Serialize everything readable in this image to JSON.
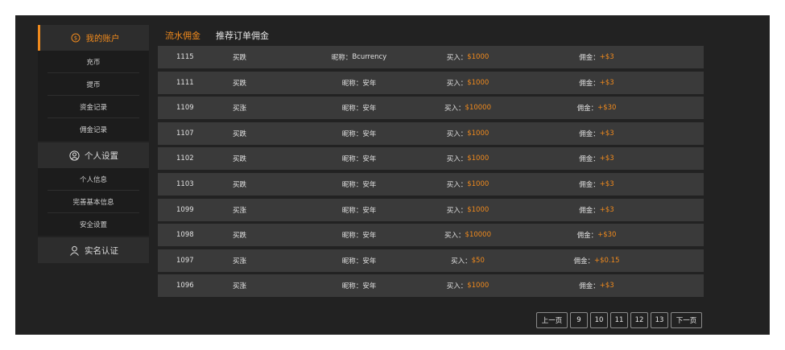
{
  "sidebar": {
    "sections": [
      {
        "title": "我的账户",
        "icon": "dollar-circle-icon",
        "active": true,
        "items": [
          "充币",
          "提币",
          "资金记录",
          "佣金记录"
        ]
      },
      {
        "title": "个人设置",
        "icon": "user-circle-icon",
        "active": false,
        "items": [
          "个人信息",
          "完善基本信息",
          "安全设置"
        ]
      },
      {
        "title": "实名认证",
        "icon": "user-icon",
        "active": false,
        "items": []
      }
    ]
  },
  "tabs": [
    {
      "label": "流水佣金",
      "active": true
    },
    {
      "label": "推荐订单佣金",
      "active": false
    }
  ],
  "labels": {
    "nickname_prefix": "昵称：",
    "buy_prefix": "买入：",
    "commission_prefix": "佣金："
  },
  "rows": [
    {
      "id": "1115",
      "type": "买跌",
      "nickname": "Bcurrency",
      "buy": "$1000",
      "commission": "+$3"
    },
    {
      "id": "1111",
      "type": "买跌",
      "nickname": "安年",
      "buy": "$1000",
      "commission": "+$3"
    },
    {
      "id": "1109",
      "type": "买涨",
      "nickname": "安年",
      "buy": "$10000",
      "commission": "+$30"
    },
    {
      "id": "1107",
      "type": "买跌",
      "nickname": "安年",
      "buy": "$1000",
      "commission": "+$3"
    },
    {
      "id": "1102",
      "type": "买跌",
      "nickname": "安年",
      "buy": "$1000",
      "commission": "+$3"
    },
    {
      "id": "1103",
      "type": "买跌",
      "nickname": "安年",
      "buy": "$1000",
      "commission": "+$3"
    },
    {
      "id": "1099",
      "type": "买涨",
      "nickname": "安年",
      "buy": "$1000",
      "commission": "+$3"
    },
    {
      "id": "1098",
      "type": "买跌",
      "nickname": "安年",
      "buy": "$10000",
      "commission": "+$30"
    },
    {
      "id": "1097",
      "type": "买涨",
      "nickname": "安年",
      "buy": "$50",
      "commission": "+$0.15"
    },
    {
      "id": "1096",
      "type": "买涨",
      "nickname": "安年",
      "buy": "$1000",
      "commission": "+$3"
    }
  ],
  "pagination": {
    "prev_label": "上一页",
    "pages": [
      "9",
      "10",
      "11",
      "12",
      "13"
    ],
    "next_label": "下一页"
  },
  "colors": {
    "accent": "#f08a1d",
    "background": "#222222",
    "row_background": "#3a3a3a"
  }
}
